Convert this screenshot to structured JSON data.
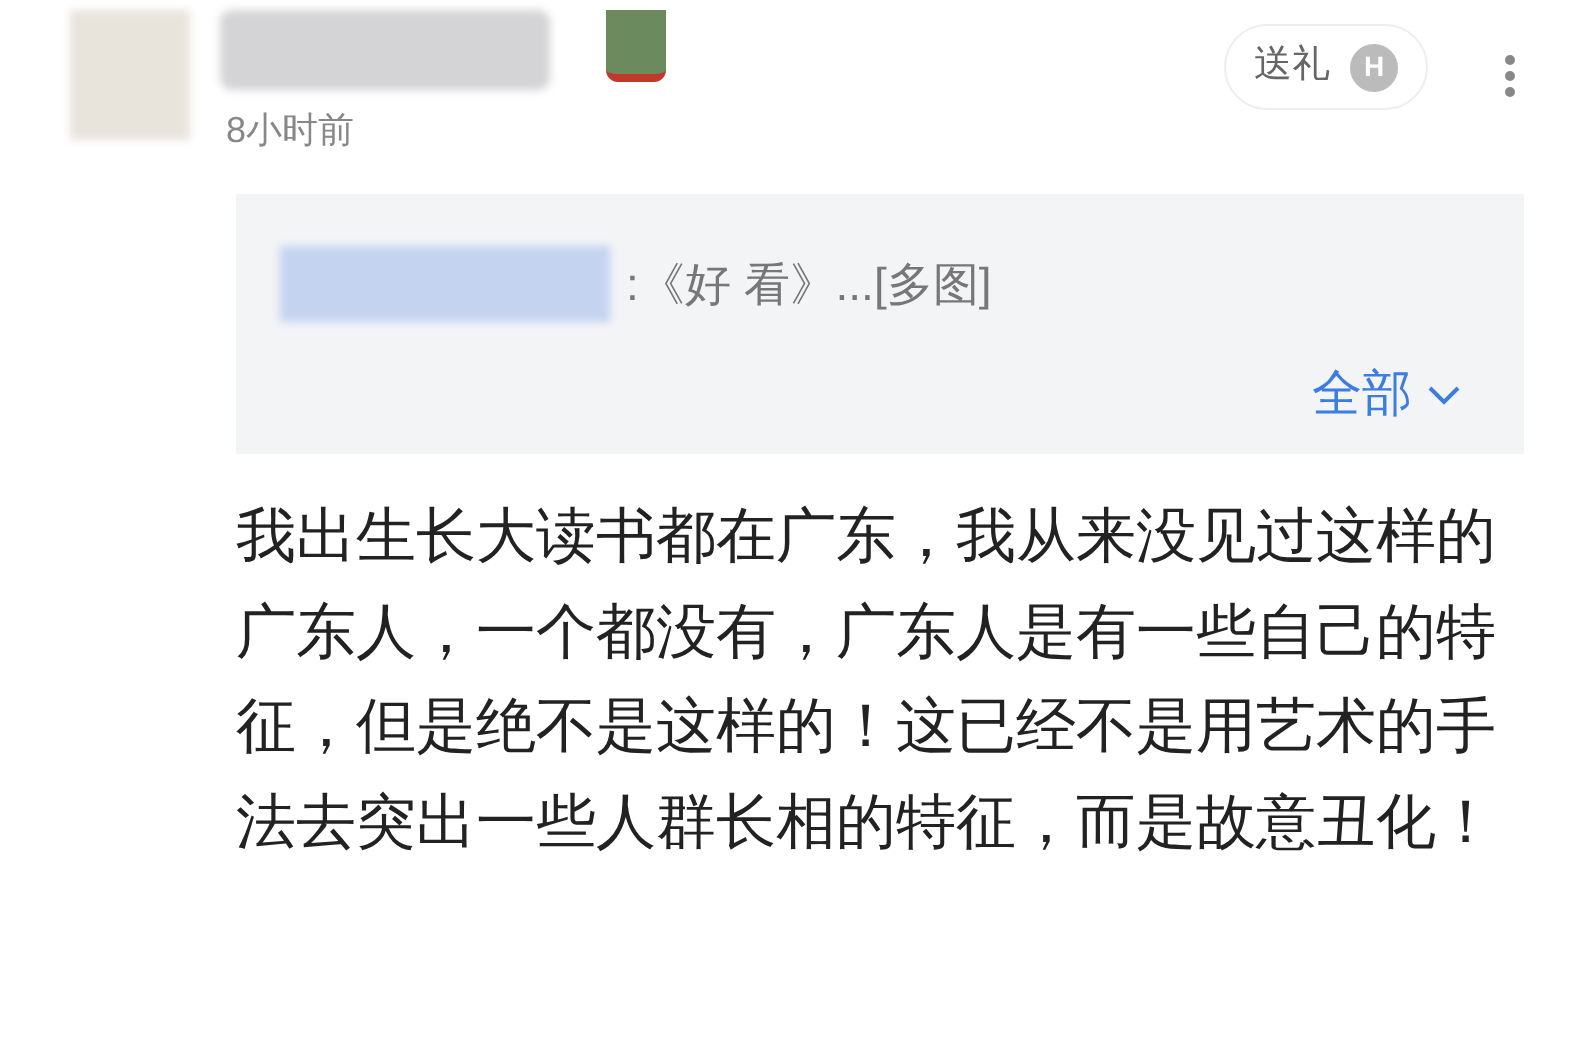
{
  "comment": {
    "time": "8小时前",
    "gift_button": "送礼",
    "gift_badge": "H",
    "quote": {
      "text": ":《好 看》...[多图]",
      "expand": "全部"
    },
    "body": "我出生长大读书都在广东，我从来没见过这样的广东人，一个都没有，广东人是有一些自己的特征，但是绝不是这样的！这已经不是用艺术的手法去突出一些人群长相的特征，而是故意丑化！"
  }
}
